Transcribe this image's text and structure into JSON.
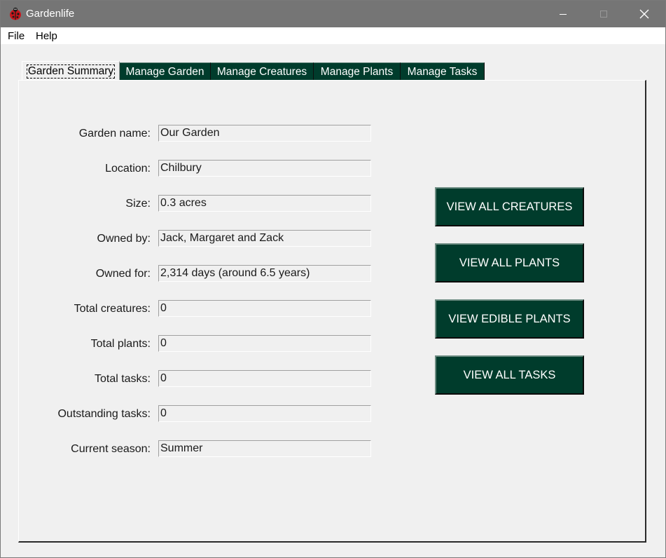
{
  "window": {
    "title": "Gardenlife",
    "controls": {
      "minimize": "minimize-icon",
      "maximize": "maximize-icon",
      "close": "close-icon"
    }
  },
  "menu": [
    "File",
    "Help"
  ],
  "tabs": [
    {
      "label": "Garden Summary",
      "active": true
    },
    {
      "label": "Manage Garden",
      "active": false
    },
    {
      "label": "Manage Creatures",
      "active": false
    },
    {
      "label": "Manage Plants",
      "active": false
    },
    {
      "label": "Manage Tasks",
      "active": false
    }
  ],
  "summary": {
    "fields": [
      {
        "label": "Garden name:",
        "value": "Our Garden"
      },
      {
        "label": "Location:",
        "value": "Chilbury"
      },
      {
        "label": "Size:",
        "value": "0.3 acres"
      },
      {
        "label": "Owned by:",
        "value": "Jack, Margaret and Zack"
      },
      {
        "label": "Owned for:",
        "value": "2,314 days (around 6.5 years)"
      },
      {
        "label": "Total creatures:",
        "value": "0"
      },
      {
        "label": "Total plants:",
        "value": "0"
      },
      {
        "label": "Total tasks:",
        "value": "0"
      },
      {
        "label": "Outstanding tasks:",
        "value": "0"
      },
      {
        "label": "Current season:",
        "value": "Summer"
      }
    ],
    "buttons": [
      "VIEW ALL CREATURES",
      "VIEW ALL PLANTS",
      "VIEW EDIBLE PLANTS",
      "VIEW ALL TASKS"
    ]
  },
  "colors": {
    "titlebar": "#757575",
    "accent": "#003c2c",
    "background": "#f0f0f0"
  }
}
